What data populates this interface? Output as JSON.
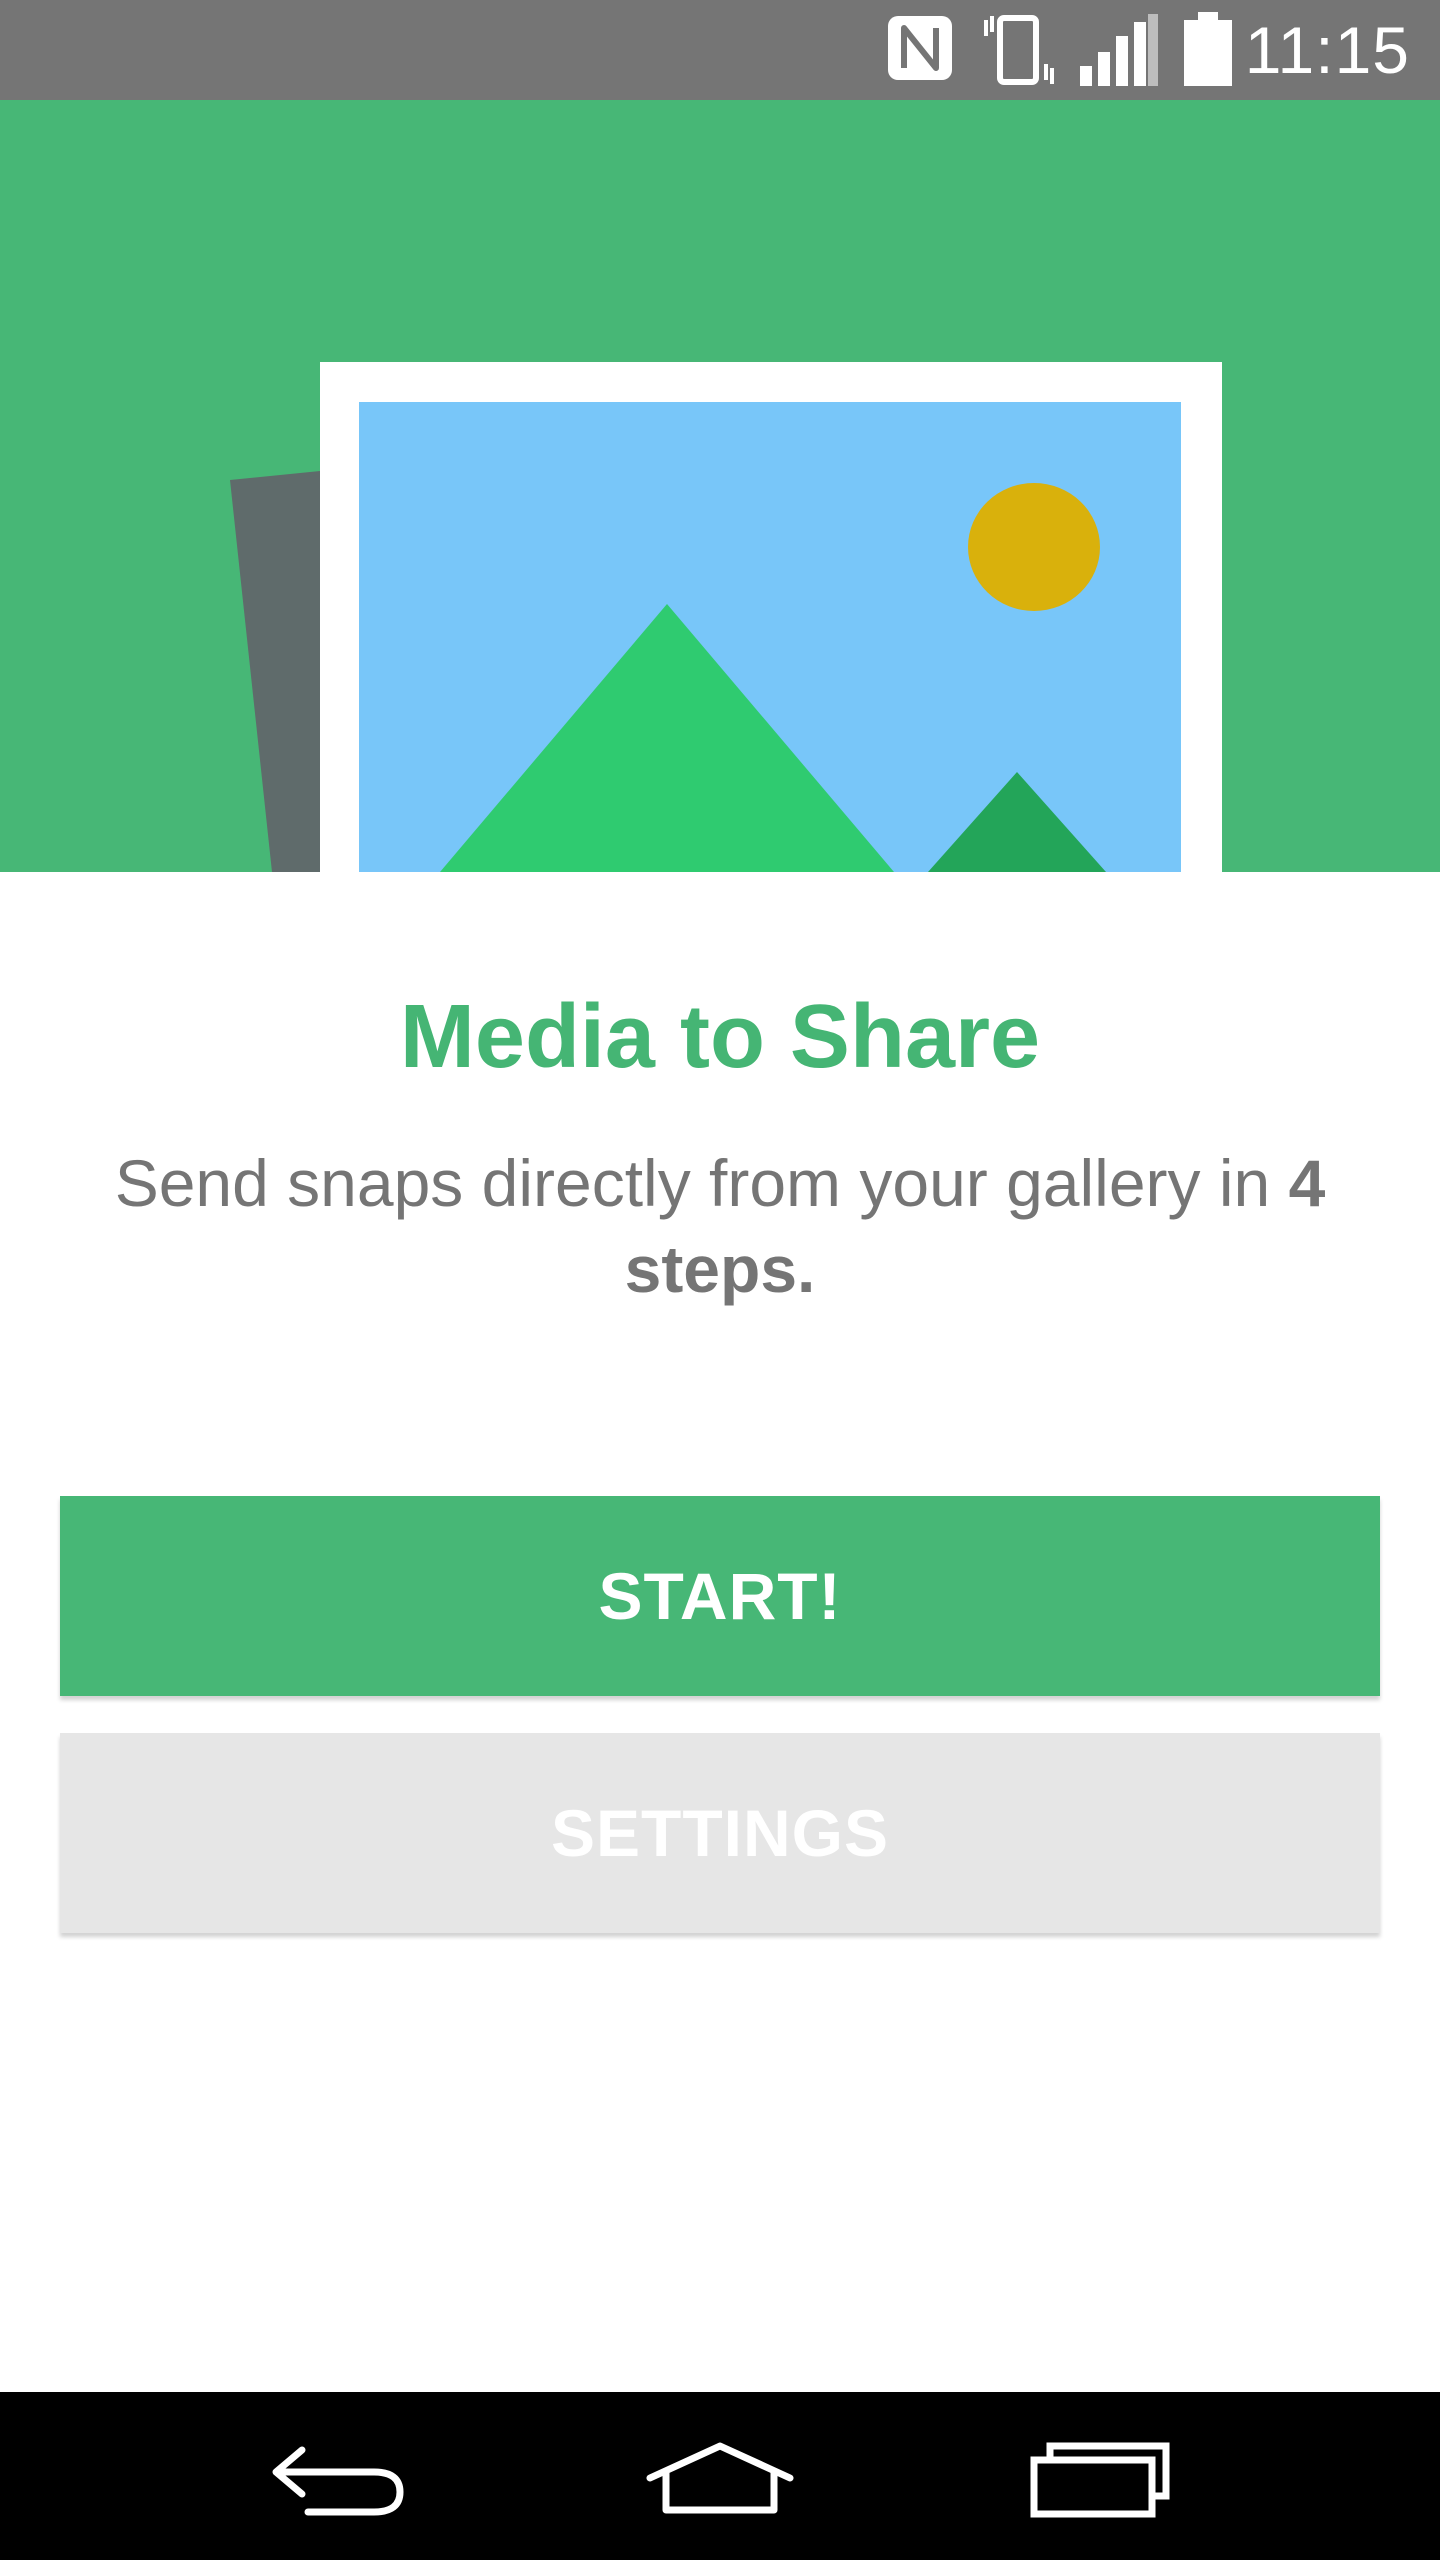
{
  "status_bar": {
    "time": "11:15",
    "icons": [
      "nfc-icon",
      "vibrate-icon",
      "signal-icon",
      "battery-icon"
    ]
  },
  "hero": {
    "illustration": "photo-gallery-icon",
    "colors": {
      "background": "#47b776",
      "sky": "#78c6f9",
      "sun": "#d9b10c",
      "mountain_large": "#2fcb70",
      "mountain_small": "#23a559",
      "frame": "#ffffff",
      "back_photo": "#5f6b6b"
    }
  },
  "content": {
    "title": "Media to Share",
    "subtitle_text": "Send snaps directly from your gallery in ",
    "subtitle_bold": "4 steps."
  },
  "buttons": {
    "start_label": "START!",
    "settings_label": "SETTINGS"
  },
  "nav_bar": {
    "icons": [
      "back-icon",
      "home-icon",
      "recent-apps-icon"
    ]
  },
  "colors": {
    "accent": "#47b776",
    "status_bar": "#757575",
    "disabled_button": "#e6e6e6",
    "body_text": "#757575"
  }
}
